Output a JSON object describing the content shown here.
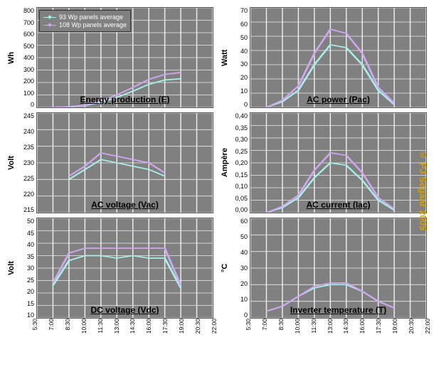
{
  "credit": "© PJ Segaar 2005",
  "legend": {
    "items": [
      {
        "name": "93",
        "label": "93 Wp panels average",
        "color": "#a7f0e6"
      },
      {
        "name": "108",
        "label": "108 Wp panels average",
        "color": "#d0a7f0"
      }
    ]
  },
  "x_axis": {
    "ticks": [
      "5:30",
      "7:00",
      "8:30",
      "10:00",
      "11:30",
      "13:00",
      "14:30",
      "16:00",
      "17:30",
      "19:00",
      "20:30",
      "22:00"
    ]
  },
  "panels": [
    {
      "id": "energy",
      "title": "Energy production (E)",
      "ylabel": "Wh",
      "ymin": 0,
      "ymax": 800,
      "ystep": 100,
      "legend_here": true
    },
    {
      "id": "pac",
      "title": "AC power (Pac)",
      "ylabel": "Watt",
      "ymin": 0,
      "ymax": 70,
      "ystep": 10
    },
    {
      "id": "vac",
      "title": "AC voltage (Vac)",
      "ylabel": "Volt",
      "ymin": 215,
      "ymax": 245,
      "ystep": 5
    },
    {
      "id": "iac",
      "title": "AC current (Iac)",
      "ylabel": "Ampère",
      "ymin": 0,
      "ymax": 0.4,
      "ystep": 0.05
    },
    {
      "id": "vdc",
      "title": "DC voltage (Vdc)",
      "ylabel": "Volt",
      "ymin": 10,
      "ymax": 50,
      "ystep": 5
    },
    {
      "id": "temp",
      "title": "Inverter temperature (T)",
      "ylabel": "°C",
      "ymin": 0,
      "ymax": 60,
      "ystep": 10
    }
  ],
  "chart_data": [
    {
      "id": "energy",
      "type": "line",
      "title": "Energy production (E)",
      "xlabel": "",
      "ylabel": "Wh",
      "ylim": [
        0,
        800
      ],
      "x_categories": [
        "7:00",
        "8:30",
        "10:00",
        "11:30",
        "13:00",
        "14:30",
        "16:00",
        "17:30",
        "19:00"
      ],
      "series": [
        {
          "name": "93",
          "values": [
            0,
            5,
            15,
            40,
            80,
            130,
            185,
            220,
            230
          ]
        },
        {
          "name": "108",
          "values": [
            0,
            6,
            18,
            50,
            100,
            160,
            225,
            265,
            280
          ]
        }
      ]
    },
    {
      "id": "pac",
      "type": "line",
      "title": "AC power (Pac)",
      "xlabel": "",
      "ylabel": "Watt",
      "ylim": [
        0,
        70
      ],
      "x_categories": [
        "7:00",
        "8:30",
        "10:00",
        "11:30",
        "13:00",
        "14:30",
        "16:00",
        "17:30",
        "19:00"
      ],
      "series": [
        {
          "name": "93",
          "values": [
            0,
            4,
            12,
            30,
            44,
            42,
            30,
            12,
            2
          ]
        },
        {
          "name": "108",
          "values": [
            0,
            5,
            15,
            38,
            55,
            52,
            38,
            14,
            3
          ]
        }
      ]
    },
    {
      "id": "vac",
      "type": "line",
      "title": "AC voltage (Vac)",
      "xlabel": "",
      "ylabel": "Volt",
      "ylim": [
        215,
        245
      ],
      "x_categories": [
        "8:30",
        "10:00",
        "11:30",
        "13:00",
        "14:30",
        "16:00",
        "17:30"
      ],
      "series": [
        {
          "name": "93",
          "values": [
            225,
            228,
            231,
            230,
            229,
            228,
            226
          ]
        },
        {
          "name": "108",
          "values": [
            226,
            229,
            233,
            232,
            231,
            230,
            227
          ]
        }
      ]
    },
    {
      "id": "iac",
      "type": "line",
      "title": "AC current (Iac)",
      "xlabel": "",
      "ylabel": "Ampère",
      "ylim": [
        0,
        0.4
      ],
      "x_categories": [
        "7:00",
        "8:30",
        "10:00",
        "11:30",
        "13:00",
        "14:30",
        "16:00",
        "17:30",
        "19:00"
      ],
      "series": [
        {
          "name": "93",
          "values": [
            0,
            0.02,
            0.06,
            0.14,
            0.2,
            0.19,
            0.13,
            0.05,
            0.01
          ]
        },
        {
          "name": "108",
          "values": [
            0,
            0.025,
            0.07,
            0.17,
            0.24,
            0.23,
            0.16,
            0.06,
            0.015
          ]
        }
      ]
    },
    {
      "id": "vdc",
      "type": "line",
      "title": "DC voltage (Vdc)",
      "xlabel": "",
      "ylabel": "Volt",
      "ylim": [
        10,
        50
      ],
      "x_categories": [
        "7:00",
        "8:30",
        "10:00",
        "11:30",
        "13:00",
        "14:30",
        "16:00",
        "17:30",
        "19:00"
      ],
      "series": [
        {
          "name": "93",
          "values": [
            23,
            33,
            35,
            35,
            34,
            35,
            34,
            34,
            22
          ]
        },
        {
          "name": "108",
          "values": [
            24,
            36,
            38,
            38,
            38,
            38,
            38,
            38,
            23
          ]
        }
      ]
    },
    {
      "id": "temp",
      "type": "line",
      "title": "Inverter temperature (T)",
      "xlabel": "",
      "ylabel": "°C",
      "ylim": [
        0,
        60
      ],
      "x_categories": [
        "7:00",
        "8:30",
        "10:00",
        "11:30",
        "13:00",
        "14:30",
        "16:00",
        "17:30",
        "19:00"
      ],
      "series": [
        {
          "name": "93",
          "values": [
            4,
            7,
            13,
            18,
            20,
            20,
            16,
            10,
            6
          ]
        },
        {
          "name": "108",
          "values": [
            4,
            7,
            13,
            19,
            21,
            21,
            16,
            10,
            6
          ]
        }
      ]
    }
  ]
}
